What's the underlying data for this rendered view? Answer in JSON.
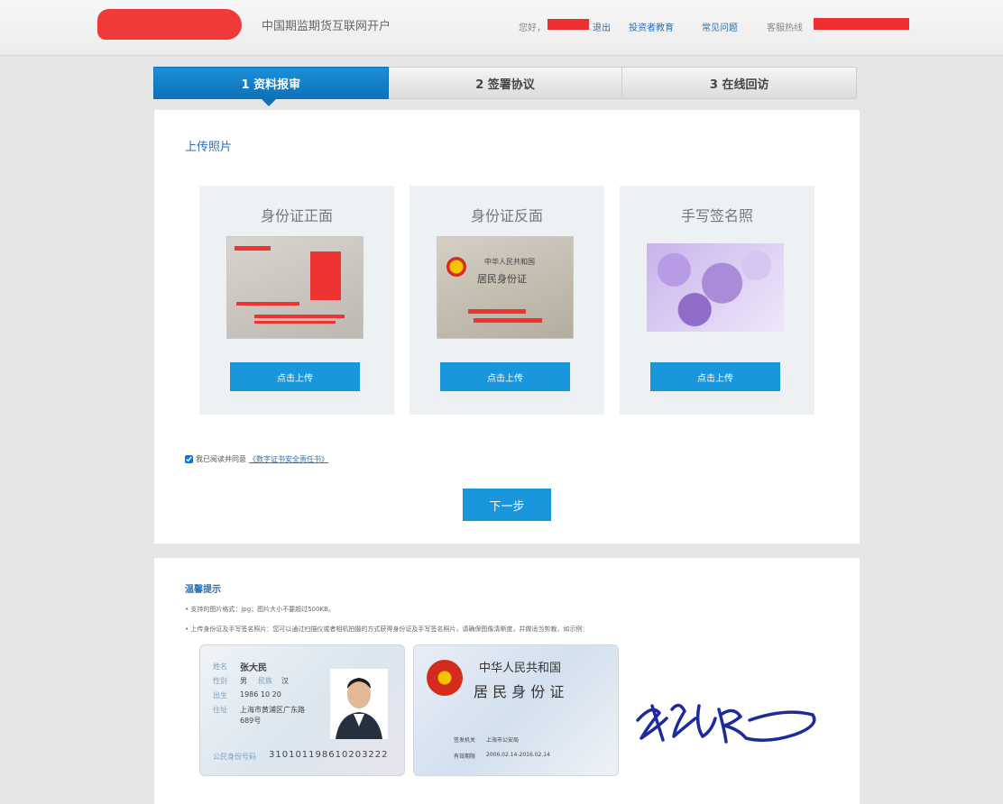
{
  "header": {
    "site_title": "中国期监期货互联网开户",
    "greeting": "您好，",
    "logout": "退出",
    "investor_edu": "投资者教育",
    "faq": "常见问题",
    "hotline_label": "客服热线"
  },
  "steps": [
    {
      "label": "1  资料报审",
      "active": true
    },
    {
      "label": "2 签署协议",
      "active": false
    },
    {
      "label": "3 在线回访",
      "active": false
    }
  ],
  "upload": {
    "section_title": "上传照片",
    "cards": [
      {
        "title": "身份证正面",
        "button": "点击上传"
      },
      {
        "title": "身份证反面",
        "button": "点击上传"
      },
      {
        "title": "手写签名照",
        "button": "点击上传"
      }
    ],
    "id_back_line1": "中华人民共和国",
    "id_back_line2": "居民身份证"
  },
  "agreement": {
    "checked": true,
    "text": "我已阅读并同意",
    "link": "《数字证书安全责任书》"
  },
  "next_button": "下一步",
  "tips": {
    "title": "温馨提示",
    "line1": "• 支持的图片格式：jpg；图片大小不要超过500KB。",
    "line2": "• 上传身份证及手写签名照片：您可以通过扫描仪或者相机拍摄的方式获得身份证及手写签名照片，请确保图像清晰度，并做适当剪裁，如示例：",
    "sample": {
      "name_label": "姓名",
      "name": "张大民",
      "gender_label": "性别",
      "gender": "男",
      "ethnic_label": "民族",
      "ethnic": "汉",
      "birth_label": "出生",
      "birth": "1986  10  20",
      "address_label": "住址",
      "address_line1": "上海市黄浦区广东路",
      "address_line2": "689号",
      "id_label": "公民身份号码",
      "id_number": "310101198610203222",
      "back_line1": "中华人民共和国",
      "back_line2": "居 民 身 份 证",
      "authority_label": "签发机关",
      "authority": "上海市公安局",
      "validity_label": "有效期限",
      "validity": "2006.02.14-2016.02.14",
      "signature": "张大民"
    }
  }
}
